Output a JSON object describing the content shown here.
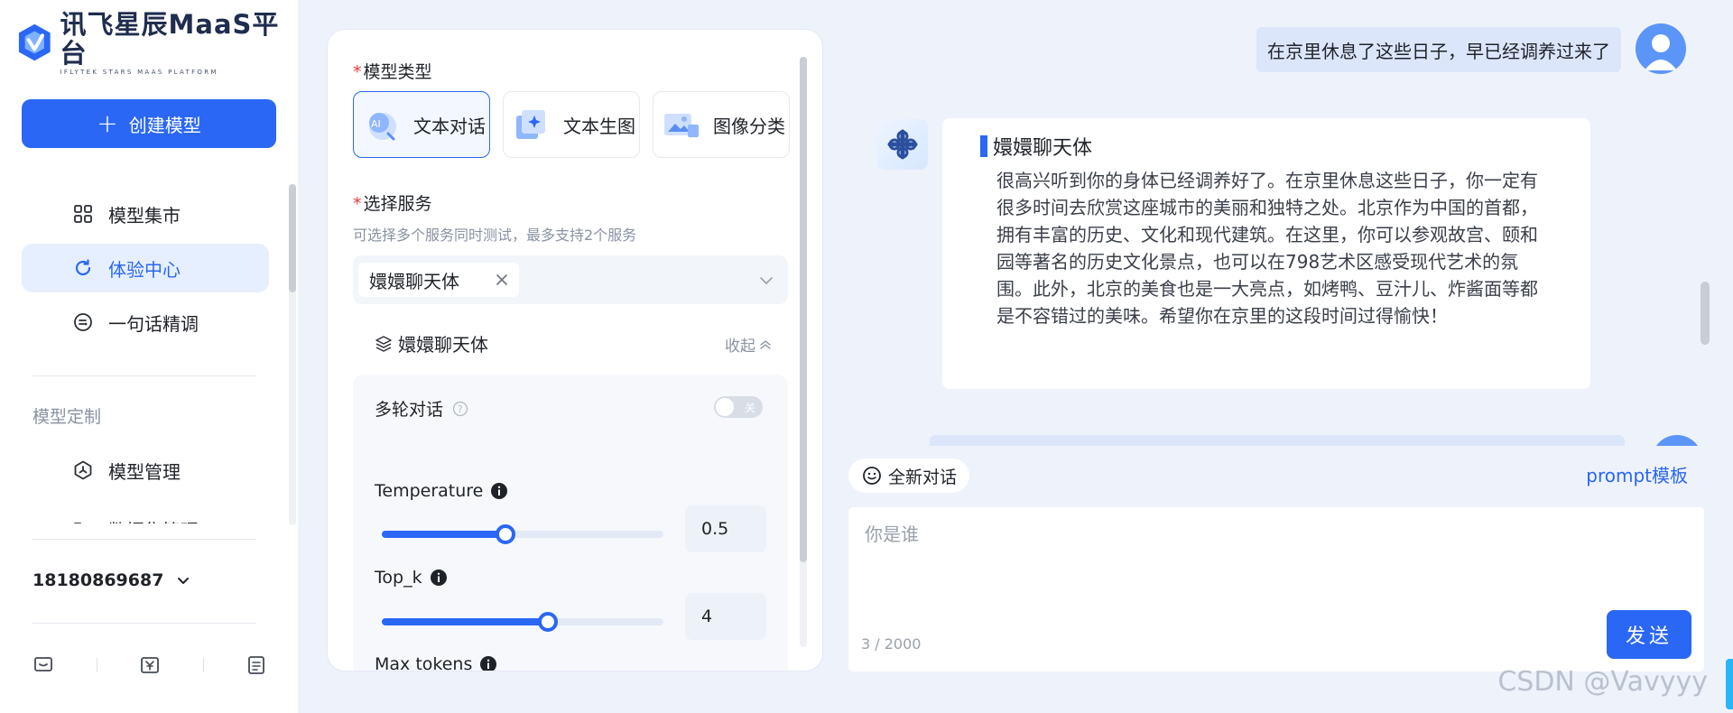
{
  "brand": {
    "title": "讯飞星辰MaaS平台",
    "subtitle": "IFLYTEK STARS MAAS PLATFORM"
  },
  "sidebar": {
    "create_label": "创建模型",
    "items": [
      {
        "label": "模型集市",
        "icon": "grid-icon"
      },
      {
        "label": "体验中心",
        "icon": "refresh-icon",
        "active": true
      },
      {
        "label": "一句话精调",
        "icon": "tune-icon"
      }
    ],
    "section_label": "模型定制",
    "custom_items": [
      {
        "label": "模型管理",
        "icon": "hexagon-icon"
      },
      {
        "label": "数据集管理",
        "icon": "folder-icon"
      }
    ],
    "phone": "18180869687",
    "bottom_icons": [
      "chat-icon",
      "yuan-icon",
      "document-icon"
    ]
  },
  "config": {
    "model_type_label": "模型类型",
    "model_types": [
      {
        "label": "文本对话",
        "icon": "chat-bot-icon",
        "active": true
      },
      {
        "label": "文本生图",
        "icon": "image-gen-icon"
      },
      {
        "label": "图像分类",
        "icon": "image-classify-icon"
      }
    ],
    "service_label": "选择服务",
    "service_hint": "可选择多个服务同时测试，最多支持2个服务",
    "selected_service": "嬛嬛聊天体",
    "service_section_title": "嬛嬛聊天体",
    "collapse_label": "收起",
    "multi_turn_label": "多轮对话",
    "multi_turn_toggle": "关",
    "params": [
      {
        "name": "Temperature",
        "value": "0.5",
        "fraction": 0.44
      },
      {
        "name": "Top_k",
        "value": "4",
        "fraction": 0.59
      },
      {
        "name": "Max tokens"
      }
    ]
  },
  "chat": {
    "user_message": "在京里休息了这些日子，早已经调养过来了",
    "bot_name": "嬛嬛聊天体",
    "bot_reply": "很高兴听到你的身体已经调养好了。在京里休息这些日子，你一定有很多时间去欣赏这座城市的美丽和独特之处。北京作为中国的首都，拥有丰富的历史、文化和现代建筑。在这里，你可以参观故宫、颐和园等著名的历史文化景点，也可以在798艺术区感受现代艺术的氛围。此外，北京的美食也是一大亮点，如烤鸭、豆汁儿、炸酱面等都是不容错过的美味。希望你在京里的这段时间过得愉快！",
    "new_chat_label": "全新对话",
    "prompt_template_label": "prompt模板",
    "input_placeholder": "你是谁",
    "counter": "3 / 2000",
    "send_label": "发送"
  },
  "watermark": "CSDN @Vavyyy",
  "colors": {
    "accent": "#2a67f5",
    "background": "#eef2fb",
    "active_nav_bg": "#e6efff",
    "required": "#f03a3a"
  }
}
